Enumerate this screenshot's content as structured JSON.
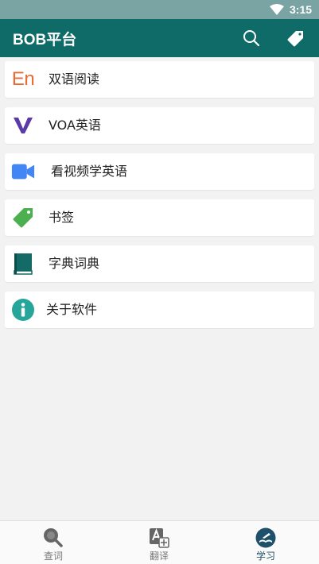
{
  "status_bar": {
    "time": "3:15",
    "icon": "wifi-icon"
  },
  "app_bar": {
    "title": "BOB平台",
    "actions": [
      {
        "name": "search-button",
        "icon": "search-icon"
      },
      {
        "name": "bookmark-button",
        "icon": "tag-icon"
      }
    ]
  },
  "menu": {
    "items": [
      {
        "label": "双语阅读",
        "icon": "en-icon",
        "icon_text": "En",
        "color": "#e96a33"
      },
      {
        "label": "VOA英语",
        "icon": "voa-v-icon",
        "color": "#5b3aa8"
      },
      {
        "label": "看视频学英语",
        "icon": "video-camera-icon",
        "color": "#4285f4"
      },
      {
        "label": "书签",
        "icon": "tag-icon",
        "color": "#4caf50"
      },
      {
        "label": "字典词典",
        "icon": "book-icon",
        "color": "#136a66"
      },
      {
        "label": "关于软件",
        "icon": "info-icon",
        "color": "#26a69a"
      }
    ]
  },
  "bottom_nav": {
    "items": [
      {
        "label": "查词",
        "icon": "magnifier-icon",
        "active": false
      },
      {
        "label": "翻译",
        "icon": "translate-icon",
        "active": false
      },
      {
        "label": "学习",
        "icon": "learn-icon",
        "active": true
      }
    ]
  },
  "colors": {
    "status_bar": "#7aa3a3",
    "app_bar": "#0f6b67",
    "background": "#f2f2f2",
    "active_nav": "#1e4f6b"
  }
}
